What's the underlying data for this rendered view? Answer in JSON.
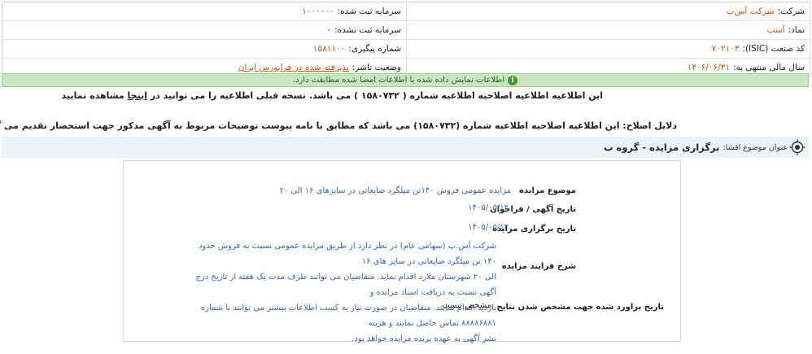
{
  "info": {
    "company_label": "شرکت:",
    "company_value": "شرکت آس‌پ",
    "registered_capital_label": "سرمایه ثبت شده:",
    "registered_capital_value": "۱۰۰۰۰۰۰",
    "symbol_label": "نماد:",
    "symbol_value": "آسپ",
    "unregistered_capital_label": "سرمایه ثبت نشده:",
    "unregistered_capital_value": "۰",
    "isic_label": "کد صنعت (ISIC):",
    "isic_value": "۷۰۲۱۰۳",
    "tracking_label": "شماره پیگیری:",
    "tracking_value": "۱۵۸۱۱۰۰",
    "fiscal_label": "سال مالی منتهی به:",
    "fiscal_value": "۱۴۰۶/۰۶/۳۱",
    "publisher_status_label": "وضعیت ناشر:",
    "publisher_status_value": "پذیرفته شده در فرابورس ایران"
  },
  "notice": {
    "icon": "info-icon",
    "text": "اطلاعات نمایش داده شده با اطلاعات امضا شده مطابقت دارد."
  },
  "correction": {
    "line1_before": "این اطلاعیه اطلاعیه اصلاحیه اطلاعیه شماره ( ۱۵۸۰۷۳۲ ) می باشد. نسخه قبلی اطلاعیه را می توانید در ",
    "line1_link": "اینجا",
    "line1_after": " مشاهده نمایید",
    "line2": "دلایل اصلاح: این اطلاعیه اصلاحیه اطلاعیه شماره (۱۵۸۰۷۳۲) می باشد که مطابق با نامه پیوست توضیحات مربوط به آگهی مذکور جهت استحضار تقدیم می گردد."
  },
  "subject": {
    "label": "عنوان موضوع افشا:",
    "title": "برگزاری مزایده - گروه ب"
  },
  "fields": {
    "auction_subject_label": "موضوع مزایده",
    "auction_subject_value": "مزایده عمومی فروش ۱۴۰تن میلگرد ضایعاتی در سایزهای ۱۶ الی ۲۰",
    "ad_date_label": "تاریخ آگهی / فراخوان",
    "ad_date_value": "۱۴۰۵/۰۵/۱۲",
    "auction_date_label": "تاریخ برگزاری مزایده",
    "auction_date_value": "۱۴۰۵/۰۵/۱۲",
    "process_label": "شرح فرایند مزایده",
    "process_line1": "شرکت آس.پ (سهامی عام) در نظر دارد از طریق مزایده عمومی نسبت به فروش حدود ۱۴۰ تن میلگرد ضایعاتی در سایز های ۱۶",
    "process_line2": "الی ۲۰ شهرستان ملارد اقدام نماید. متقاضیان می توانند ظرف مدت یک هفته از تاریخ درج آگهی نسبت به دریافت اسناد مزایده و",
    "process_line3": "بازدید اقدام نمایند. متقاضیان در صورت نیاز به کسب اطلاعات بیشتر می توانند با شماره ۸۸۸۸۶۸۸۱ تماس حاصل نمایند و هزینه",
    "process_line4": "نشر آگهی به عهده برنده مزایده خواهد بود.",
    "estimate_label": "تاریخ براورد شده جهت مشخص شدن نتایج",
    "estimate_value": "مشخص نیست"
  },
  "colors": {
    "accent_orange": "#c05a1c",
    "value_blue": "#3a68b8",
    "notice_green": "#c9e6c0",
    "subject_bar": "#eaf2fa"
  }
}
